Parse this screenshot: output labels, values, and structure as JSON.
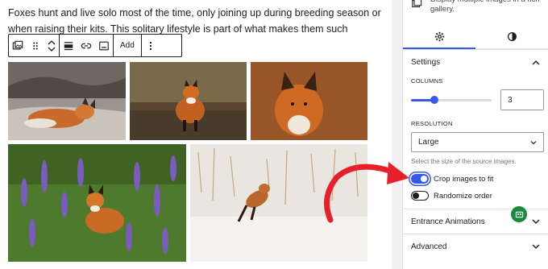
{
  "editor": {
    "paragraph": "Foxes hunt and live solo most of the time, only joining up during breeding season or when raising their kits. This solitary lifestyle is part of what makes them such mysterious",
    "toolbar": {
      "add_label": "Add",
      "icons": [
        "gallery-icon",
        "drag-handle-icon",
        "move-up-icon",
        "move-down-icon",
        "align-icon",
        "link-icon",
        "caption-icon",
        "more-options-icon"
      ]
    },
    "gallery": {
      "images": [
        {
          "name": "fox-sleeping"
        },
        {
          "name": "fox-walking"
        },
        {
          "name": "fox-portrait"
        },
        {
          "name": "fox-in-flowers"
        },
        {
          "name": "fox-jumping-snow"
        }
      ]
    }
  },
  "sidebar": {
    "description": "Display multiple images in a rich gallery.",
    "tabs": [
      {
        "name": "settings-tab",
        "icon": "gear-icon",
        "active": true
      },
      {
        "name": "styles-tab",
        "icon": "contrast-icon",
        "active": false
      }
    ],
    "settings": {
      "title": "Settings",
      "columns_label": "COLUMNS",
      "columns_value": "3",
      "columns_min": 1,
      "columns_max": 8,
      "resolution_label": "RESOLUTION",
      "resolution_value": "Large",
      "resolution_help": "Select the size of the source images.",
      "crop_label": "Crop images to fit",
      "crop_on": true,
      "randomize_label": "Randomize order",
      "randomize_on": false
    },
    "panels": [
      {
        "title": "Entrance Animations"
      },
      {
        "title": "Advanced"
      }
    ]
  },
  "colors": {
    "accent": "#3858e9",
    "annotation_arrow": "#e5202a",
    "badge": "#1a8a3a"
  }
}
